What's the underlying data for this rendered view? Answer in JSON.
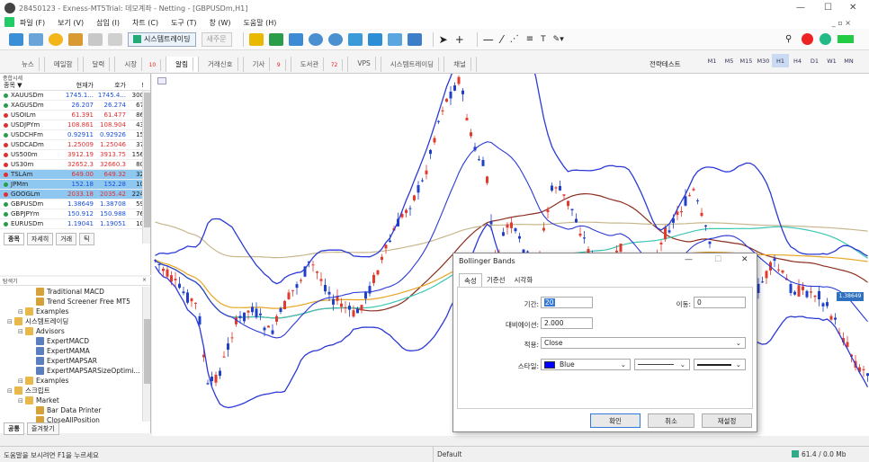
{
  "window": {
    "title": "28450123 - Exness-MT5Trial: 데모계좌 - Netting - [GBPUSDm,H1]"
  },
  "menu": [
    "파일 (F)",
    "보기 (V)",
    "삽입 (I)",
    "차트 (C)",
    "도구 (T)",
    "창 (W)",
    "도움말 (H)"
  ],
  "toolbar": {
    "algo_label": "시스템트레이딩",
    "new_order": "새주문"
  },
  "tabs": [
    {
      "label": "뉴스",
      "badge": ""
    },
    {
      "label": "메일함",
      "badge": ""
    },
    {
      "label": "달력",
      "badge": ""
    },
    {
      "label": "시장",
      "badge": "10"
    },
    {
      "label": "알림",
      "badge": ""
    },
    {
      "label": "거래신호",
      "badge": ""
    },
    {
      "label": "기사",
      "badge": "9"
    },
    {
      "label": "도서관",
      "badge": "72"
    },
    {
      "label": "VPS",
      "badge": ""
    },
    {
      "label": "시스템트레이딩",
      "badge": ""
    },
    {
      "label": "채널",
      "badge": ""
    }
  ],
  "strategy_tester": "전략테스트",
  "timeframes": [
    "M1",
    "M5",
    "M15",
    "M30",
    "H1",
    "H4",
    "D1",
    "W1",
    "MN"
  ],
  "market_watch": {
    "title": "종합시세",
    "columns": [
      "종목 ▼",
      "현재가",
      "호가",
      "!"
    ],
    "rows": [
      {
        "symbol": "XAUUSDm",
        "bid": "1745.1...",
        "ask": "1745.4...",
        "spread": "300",
        "dir": "up",
        "sel": false
      },
      {
        "symbol": "XAGUSDm",
        "bid": "26.207",
        "ask": "26.274",
        "spread": "67",
        "dir": "up",
        "sel": false
      },
      {
        "symbol": "USOILm",
        "bid": "61.391",
        "ask": "61.477",
        "spread": "86",
        "dir": "dn",
        "sel": false
      },
      {
        "symbol": "USDJPYm",
        "bid": "108.861",
        "ask": "108.904",
        "spread": "43",
        "dir": "dn",
        "sel": false
      },
      {
        "symbol": "USDCHFm",
        "bid": "0.92911",
        "ask": "0.92926",
        "spread": "15",
        "dir": "up",
        "sel": false
      },
      {
        "symbol": "USDCADm",
        "bid": "1.25009",
        "ask": "1.25046",
        "spread": "37",
        "dir": "dn",
        "sel": false
      },
      {
        "symbol": "US500m",
        "bid": "3912.19",
        "ask": "3913.75",
        "spread": "156",
        "dir": "dn",
        "sel": false
      },
      {
        "symbol": "US30m",
        "bid": "32652.3",
        "ask": "32660.3",
        "spread": "80",
        "dir": "dn",
        "sel": false
      },
      {
        "symbol": "TSLAm",
        "bid": "649.00",
        "ask": "649.32",
        "spread": "32",
        "dir": "dn",
        "sel": true
      },
      {
        "symbol": "JPMm",
        "bid": "152.18",
        "ask": "152.28",
        "spread": "10",
        "dir": "up",
        "sel": true
      },
      {
        "symbol": "GOOGLm",
        "bid": "2033.18",
        "ask": "2035.42",
        "spread": "224",
        "dir": "dn",
        "sel": true
      },
      {
        "symbol": "GBPUSDm",
        "bid": "1.38649",
        "ask": "1.38708",
        "spread": "59",
        "dir": "up",
        "sel": false
      },
      {
        "symbol": "GBPJPYm",
        "bid": "150.912",
        "ask": "150.988",
        "spread": "76",
        "dir": "up",
        "sel": false
      },
      {
        "symbol": "EURUSDm",
        "bid": "1.19041",
        "ask": "1.19051",
        "spread": "10",
        "dir": "up",
        "sel": false
      }
    ],
    "tabs": [
      "종목",
      "자세히",
      "거래",
      "틱"
    ]
  },
  "navigator": {
    "title": "탐색기",
    "items": [
      {
        "label": "Traditional MACD",
        "indent": 3,
        "icon": "indicator"
      },
      {
        "label": "Trend Screener Free MT5",
        "indent": 3,
        "icon": "indicator"
      },
      {
        "label": "Examples",
        "indent": 2,
        "icon": "folder"
      },
      {
        "label": "시스템트레이딩",
        "indent": 1,
        "icon": "folder"
      },
      {
        "label": "Advisors",
        "indent": 2,
        "icon": "folder"
      },
      {
        "label": "ExpertMACD",
        "indent": 3,
        "icon": "expert"
      },
      {
        "label": "ExpertMAMA",
        "indent": 3,
        "icon": "expert"
      },
      {
        "label": "ExpertMAPSAR",
        "indent": 3,
        "icon": "expert"
      },
      {
        "label": "ExpertMAPSARSizeOptimi...",
        "indent": 3,
        "icon": "expert"
      },
      {
        "label": "Examples",
        "indent": 2,
        "icon": "folder"
      },
      {
        "label": "스크립트",
        "indent": 1,
        "icon": "folder"
      },
      {
        "label": "Market",
        "indent": 2,
        "icon": "folder"
      },
      {
        "label": "Bar Data Printer",
        "indent": 3,
        "icon": "script"
      },
      {
        "label": "CloseAllPosition",
        "indent": 3,
        "icon": "script"
      }
    ],
    "tabs": [
      "공통",
      "즐겨찾기"
    ]
  },
  "chart": {
    "symbol": "GBPUSDm",
    "timeframe": "H1",
    "price_label": "1.38649",
    "bull": "#e23b2e",
    "bear": "#2040c8",
    "band": "#2b3ad6"
  },
  "dialog": {
    "title": "Bollinger Bands",
    "tabs": [
      "속성",
      "기준선",
      "시각화"
    ],
    "period_label": "기간:",
    "period": "20",
    "shift_label": "이동:",
    "shift": "0",
    "deviation_label": "대비에이션:",
    "deviation": "2.000",
    "apply_label": "적용:",
    "apply": "Close",
    "style_label": "스타일:",
    "color_name": "Blue",
    "ok": "확인",
    "cancel": "취소",
    "reset": "재설정"
  },
  "status": {
    "help": "도움말을 보시려면 F1을 누르세요",
    "profile": "Default",
    "traffic": "61.4 / 0.0 Mb"
  }
}
